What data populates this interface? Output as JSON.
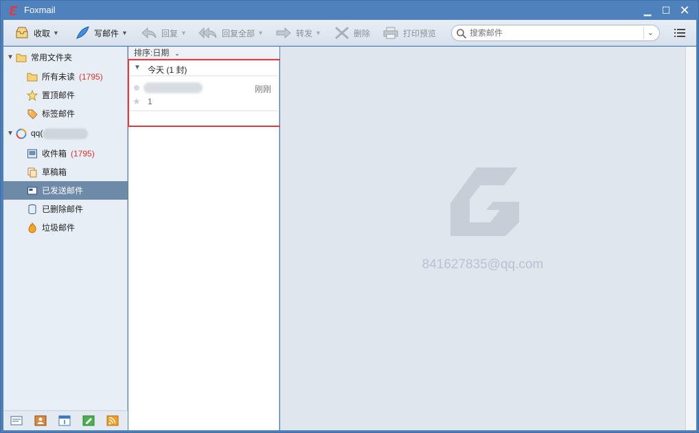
{
  "window": {
    "title": "Foxmail"
  },
  "toolbar": {
    "receive": "收取",
    "compose": "写邮件",
    "reply": "回复",
    "reply_all": "回复全部",
    "forward": "转发",
    "delete": "删除",
    "print_preview": "打印预览",
    "search_placeholder": "搜索邮件"
  },
  "sidebar": {
    "common_folder": "常用文件夹",
    "all_unread": "所有未读",
    "all_unread_count": "(1795)",
    "starred": "置顶邮件",
    "tagged": "标签邮件",
    "account_prefix": "qq(",
    "inbox": "收件箱",
    "inbox_count": "(1795)",
    "drafts": "草稿箱",
    "sent": "已发送邮件",
    "deleted": "已删除邮件",
    "spam": "垃圾邮件"
  },
  "list": {
    "sort_label": "排序:日期",
    "group_label": "今天 (1 封)",
    "mail": {
      "time": "刚刚",
      "subject": "1"
    }
  },
  "preview": {
    "account_email": "841627835@qq.com"
  },
  "colors": {
    "accent": "#4f82bd",
    "selected": "#6d8aa9",
    "count": "#e0322c",
    "highlight": "#e8373b"
  }
}
